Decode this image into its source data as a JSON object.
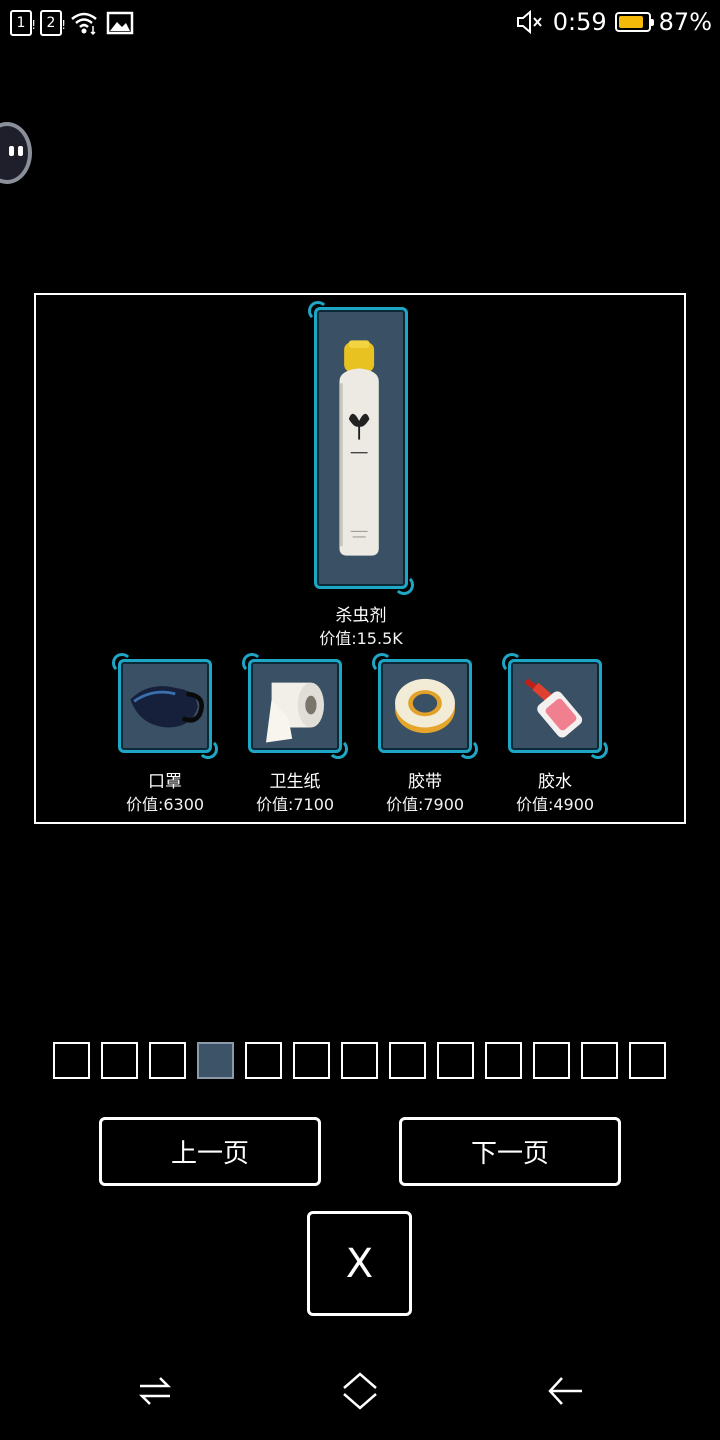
{
  "status_bar": {
    "sim1": "1",
    "sim2": "2",
    "time": "0:59",
    "battery_percent": "87%",
    "battery_level": 0.87,
    "battery_color": "#f5b90a"
  },
  "featured_item": {
    "name": "杀虫剂",
    "value": "价值:15.5K",
    "icon": "insecticide-spray-can-icon"
  },
  "items": [
    {
      "name": "口罩",
      "value": "价值:6300",
      "icon": "face-mask-icon"
    },
    {
      "name": "卫生纸",
      "value": "价值:7100",
      "icon": "toilet-paper-icon"
    },
    {
      "name": "胶带",
      "value": "价值:7900",
      "icon": "tape-roll-icon"
    },
    {
      "name": "胶水",
      "value": "价值:4900",
      "icon": "glue-bottle-icon"
    }
  ],
  "pager": {
    "total": 13,
    "current": 4
  },
  "buttons": {
    "prev": "上一页",
    "next": "下一页",
    "close": "X"
  },
  "colors": {
    "slot_bg": "#3a5064",
    "slot_border": "#1fa6c4",
    "active_page": "#3d5468"
  }
}
